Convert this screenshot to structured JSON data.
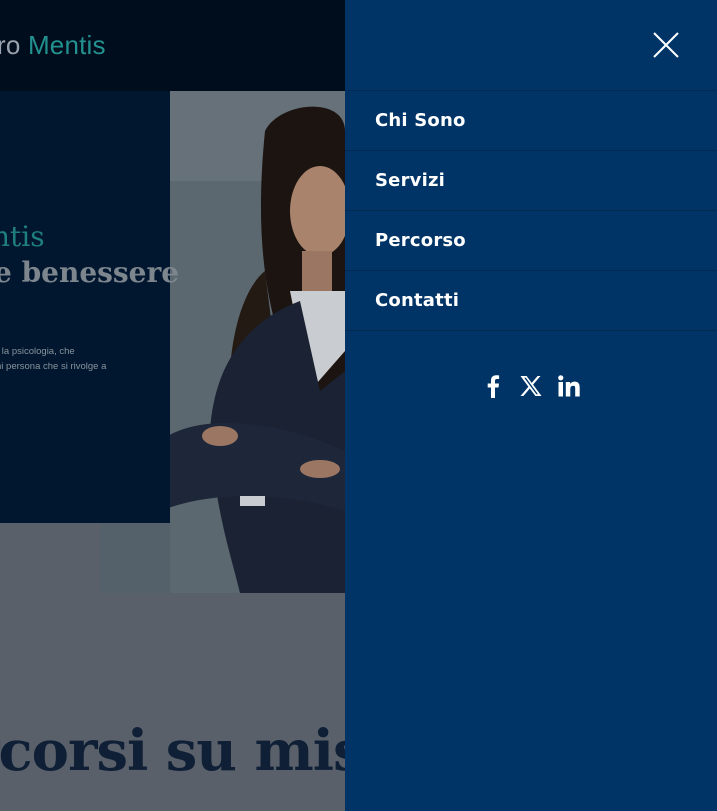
{
  "background": {
    "brand": {
      "prefix": "ro ",
      "accent": "Mentis"
    },
    "hero": {
      "title_line_1": "ntis",
      "title_line_2": "e benessere",
      "copy_line_1": "r la psicologia, che",
      "copy_line_2": "ni persona che si rivolge a"
    },
    "section_heading": "rcorsi su misu"
  },
  "menu": {
    "close_icon": "close-icon",
    "items": [
      {
        "label": "Chi Sono"
      },
      {
        "label": "Servizi"
      },
      {
        "label": "Percorso"
      },
      {
        "label": "Contatti"
      }
    ],
    "social": [
      {
        "icon": "facebook-icon"
      },
      {
        "icon": "x-twitter-icon"
      },
      {
        "icon": "linkedin-icon"
      }
    ]
  },
  "colors": {
    "menu_bg": "#003466",
    "accent": "#22918f",
    "overlay": "rgba(0,0,0,0.6)"
  }
}
